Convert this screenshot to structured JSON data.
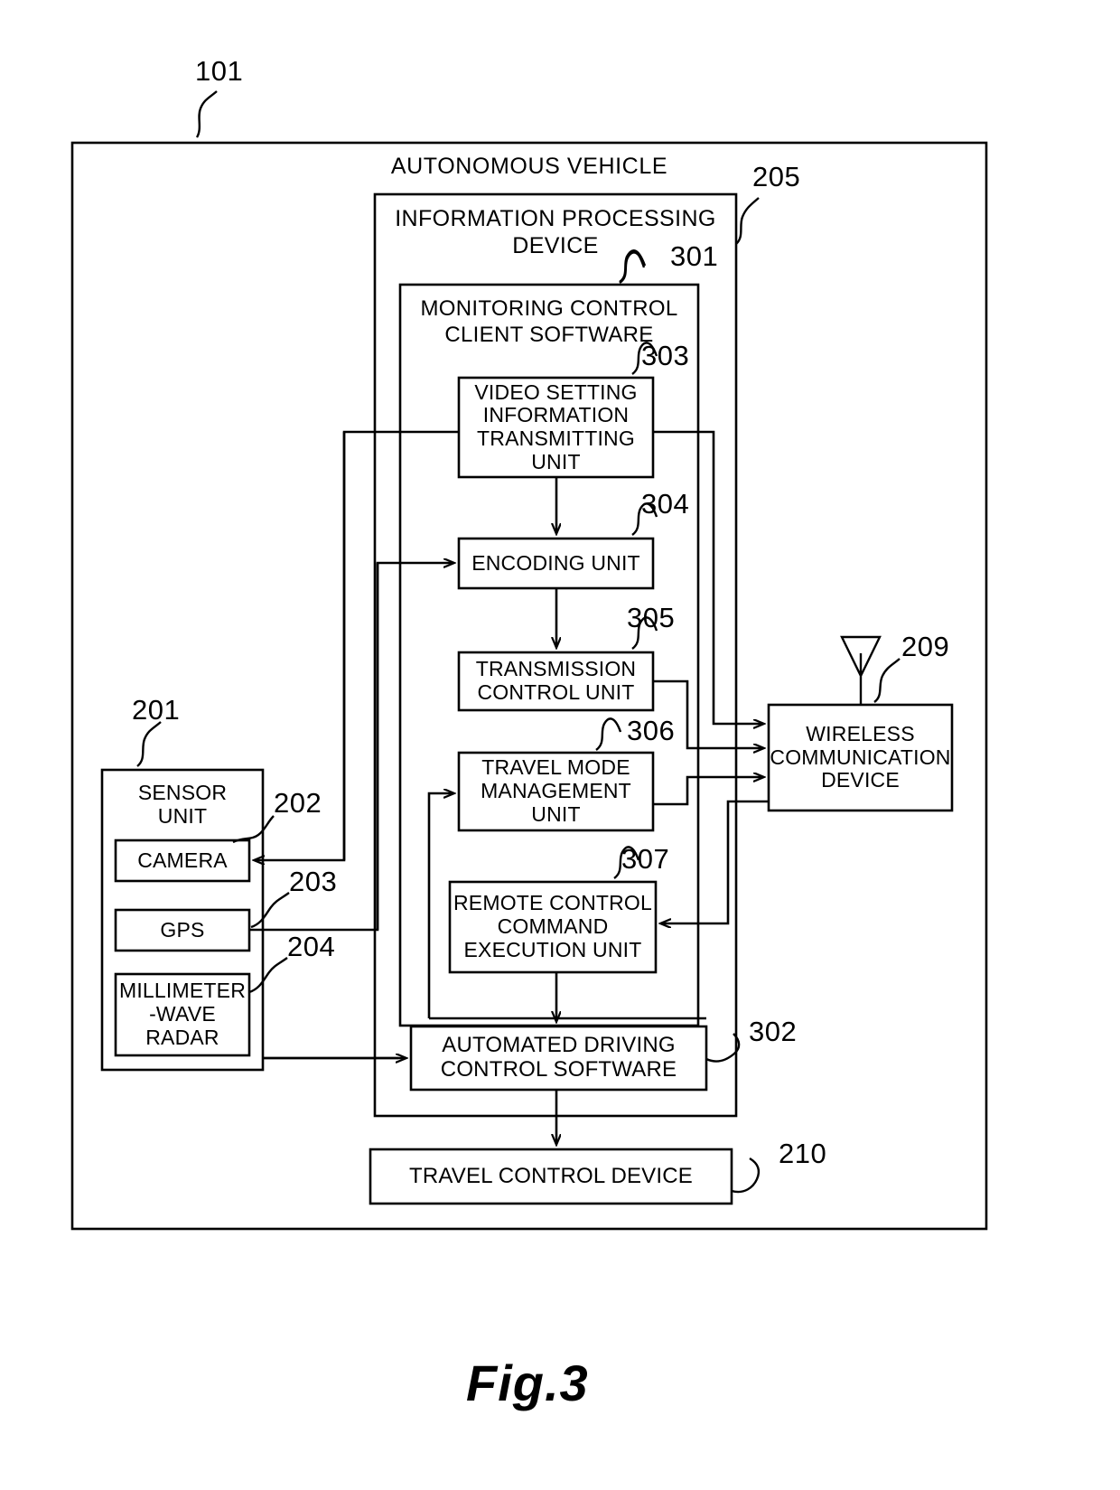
{
  "figure": {
    "caption": "Fig.3",
    "domain_type": "patent-block-diagram"
  },
  "outer": {
    "ref": "101",
    "title": "AUTONOMOUS VEHICLE"
  },
  "info_device": {
    "ref": "205",
    "title": "INFORMATION PROCESSING\nDEVICE"
  },
  "client_software": {
    "ref": "301",
    "title": "MONITORING CONTROL\nCLIENT SOFTWARE"
  },
  "units": [
    {
      "ref": "303",
      "label": "VIDEO SETTING\nINFORMATION\nTRANSMITTING\nUNIT"
    },
    {
      "ref": "304",
      "label": "ENCODING UNIT"
    },
    {
      "ref": "305",
      "label": "TRANSMISSION\nCONTROL UNIT"
    },
    {
      "ref": "306",
      "label": "TRAVEL MODE\nMANAGEMENT\nUNIT"
    },
    {
      "ref": "307",
      "label": "REMOTE CONTROL\nCOMMAND\nEXECUTION UNIT"
    }
  ],
  "automated_driving": {
    "ref": "302",
    "label": "AUTOMATED DRIVING\nCONTROL SOFTWARE"
  },
  "travel_control": {
    "ref": "210",
    "label": "TRAVEL CONTROL DEVICE"
  },
  "wireless": {
    "ref": "209",
    "label": "WIRELESS\nCOMMUNICATION\nDEVICE",
    "antenna_icon": "antenna-icon"
  },
  "sensor_unit": {
    "ref": "201",
    "label": "SENSOR\nUNIT",
    "sensors": [
      {
        "ref": "202",
        "label": "CAMERA"
      },
      {
        "ref": "203",
        "label": "GPS"
      },
      {
        "ref": "204",
        "label": "MILLIMETER\n-WAVE\nRADAR"
      }
    ]
  },
  "colors": {
    "line": "#000000",
    "background": "#ffffff"
  }
}
